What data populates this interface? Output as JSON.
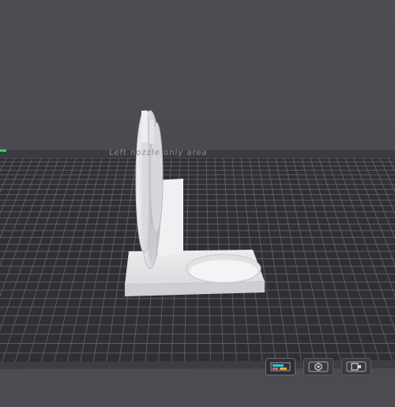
{
  "viewport": {
    "plate_label": "Left nozzle only area",
    "colors": {
      "background": "#4b4b51",
      "bed": "#2f2f35",
      "grid": "#5c5c63",
      "model": "#e6e6e8",
      "axis": "#2fd36a"
    }
  },
  "toolbar": {
    "buttons": [
      {
        "icon": "view-layers-icon",
        "active": true
      },
      {
        "icon": "settings-hex-icon",
        "active": false
      },
      {
        "icon": "print-preview-icon",
        "active": false
      }
    ]
  }
}
